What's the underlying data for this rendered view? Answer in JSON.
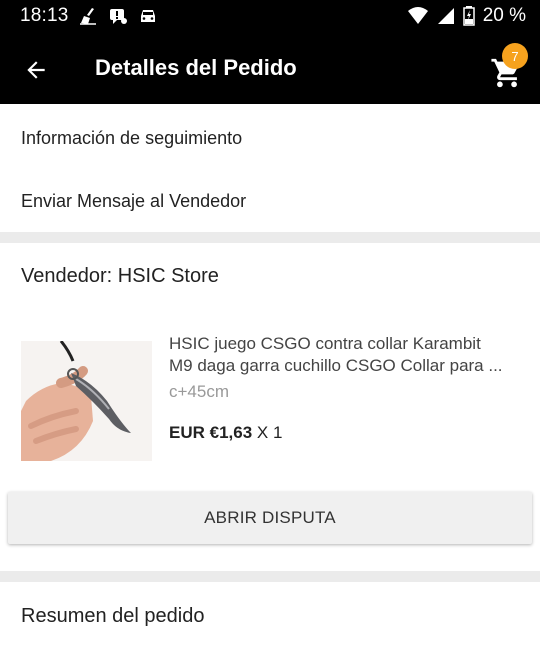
{
  "status_bar": {
    "time": "18:13",
    "battery": "20 %",
    "icons": [
      "broom-icon",
      "alert-message-icon",
      "car-icon",
      "wifi-icon",
      "signal-icon",
      "battery-icon"
    ]
  },
  "app_bar": {
    "title": "Detalles del Pedido",
    "cart_count": "7",
    "back_icon": "arrow-back-icon",
    "cart_icon": "shopping-cart-icon"
  },
  "menu": {
    "tracking": "Información de seguimiento",
    "message_seller": "Enviar Mensaje al Vendedor"
  },
  "order_item": {
    "seller": "Vendedor: HSIC Store",
    "title_line1": "HSIC juego CSGO contra collar Karambit",
    "title_line2": "M9 daga garra cuchillo CSGO Collar para ...",
    "variant": "c+45cm",
    "price": "EUR €1,63",
    "quantity": "X 1",
    "dispute_button": "ABRIR DISPUTA"
  },
  "summary": {
    "title": "Resumen del pedido"
  },
  "colors": {
    "app_bar": "#000000",
    "badge": "#f6a21e",
    "background": "#ebebeb"
  }
}
